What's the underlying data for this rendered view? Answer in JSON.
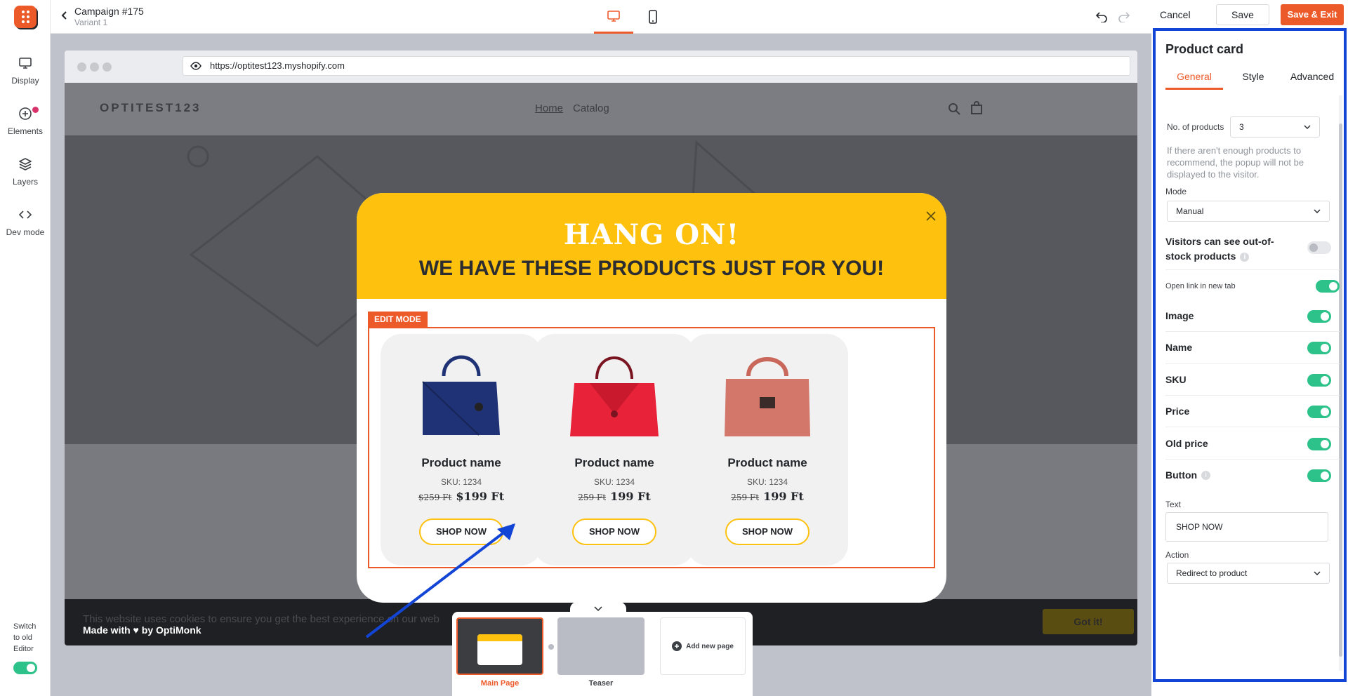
{
  "app": {
    "campaign_title": "Campaign #175",
    "variant": "Variant 1"
  },
  "sidebar": {
    "items": [
      {
        "label": "Display",
        "icon": "monitor-icon"
      },
      {
        "label": "Elements",
        "icon": "plus-circle-icon"
      },
      {
        "label": "Layers",
        "icon": "layers-icon"
      },
      {
        "label": "Dev mode",
        "icon": "code-icon"
      }
    ],
    "switch_label_1": "Switch",
    "switch_label_2": "to old",
    "switch_label_3": "Editor",
    "switch_on": true
  },
  "toolbar": {
    "cancel": "Cancel",
    "save": "Save",
    "save_exit": "Save & Exit"
  },
  "browser": {
    "url": "https://optitest123.myshopify.com"
  },
  "site": {
    "brand": "OPTITEST123",
    "nav": [
      "Home",
      "Catalog"
    ],
    "cookie_text": "This website uses cookies to ensure you get the best experience on our web",
    "made_with": "Made with ♥ by OptiMonk",
    "got_it": "Got it!"
  },
  "popup": {
    "headline": "HANG ON!",
    "subheadline": "WE HAVE THESE PRODUCTS JUST FOR YOU!",
    "edit_badge": "EDIT MODE",
    "products": [
      {
        "name": "Product name",
        "sku": "SKU: 1234",
        "old_price": "$259 Ft",
        "price": "$199 Ft",
        "button": "SHOP NOW",
        "color": "#1f3276"
      },
      {
        "name": "Product name",
        "sku": "SKU: 1234",
        "old_price": "259 Ft",
        "price": "199 Ft",
        "button": "SHOP NOW",
        "color": "#e82238"
      },
      {
        "name": "Product name",
        "sku": "SKU: 1234",
        "old_price": "259 Ft",
        "price": "199 Ft",
        "button": "SHOP NOW",
        "color": "#d2776a"
      }
    ]
  },
  "pages": {
    "items": [
      {
        "label": "Main Page",
        "active": true
      },
      {
        "label": "Teaser",
        "active": false
      }
    ],
    "add_label": "Add new page"
  },
  "panel": {
    "title": "Product card",
    "tabs": [
      "General",
      "Style",
      "Advanced"
    ],
    "active_tab": "General",
    "no_products_label": "No. of products",
    "no_products_value": "3",
    "hint": "If there aren't enough products to recommend, the popup will not be displayed to the visitor.",
    "mode_label": "Mode",
    "mode_value": "Manual",
    "out_of_stock_label": "Visitors can see out-of-stock products",
    "out_of_stock_on": false,
    "open_new_tab_label": "Open link in new tab",
    "open_new_tab_on": true,
    "toggles": [
      {
        "label": "Image",
        "on": true
      },
      {
        "label": "Name",
        "on": true
      },
      {
        "label": "SKU",
        "on": true
      },
      {
        "label": "Price",
        "on": true
      },
      {
        "label": "Old price",
        "on": true
      },
      {
        "label": "Button",
        "on": true
      }
    ],
    "text_label": "Text",
    "text_value": "SHOP NOW",
    "action_label": "Action",
    "action_value": "Redirect to product"
  },
  "colors": {
    "accent": "#ed5a29",
    "popup_yellow": "#fec10e",
    "toggle_green": "#2ec28b",
    "highlight_blue": "#1245d6"
  }
}
